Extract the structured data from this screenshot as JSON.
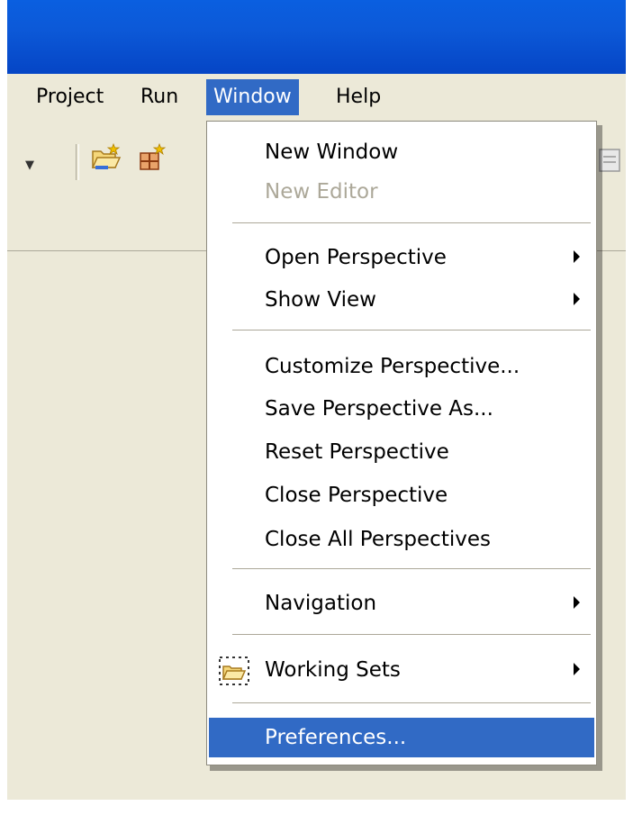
{
  "menubar": {
    "items": [
      {
        "label": "Project"
      },
      {
        "label": "Run"
      },
      {
        "label": "Window"
      },
      {
        "label": "Help"
      }
    ]
  },
  "toolbar": {
    "icons": [
      "new-project-icon",
      "new-package-icon",
      "toolbar-icon-partial"
    ]
  },
  "window_menu": {
    "new_window": "New Window",
    "new_editor": "New Editor",
    "open_perspective": "Open Perspective",
    "show_view": "Show View",
    "customize_perspective": "Customize Perspective...",
    "save_perspective_as": "Save Perspective As...",
    "reset_perspective": "Reset Perspective",
    "close_perspective": "Close Perspective",
    "close_all_perspectives": "Close All Perspectives",
    "navigation": "Navigation",
    "working_sets": "Working Sets",
    "preferences": "Preferences..."
  },
  "colors": {
    "title_bar": "#0a5fe0",
    "selection": "#316ac5",
    "background": "#ece9d8",
    "disabled_text": "#aca899"
  }
}
